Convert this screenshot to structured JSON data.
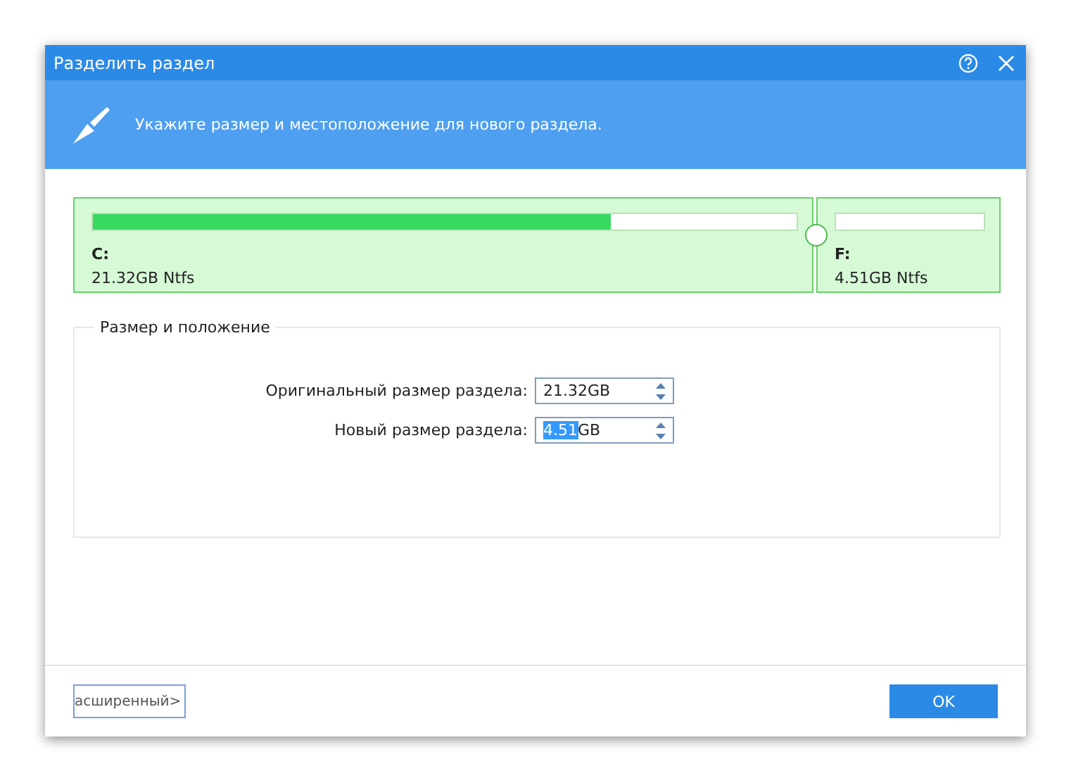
{
  "window": {
    "title": "Разделить раздел"
  },
  "banner": {
    "text": "Укажите размер и местоположение для нового раздела."
  },
  "partitions": [
    {
      "letter": "C:",
      "info": "21.32GB Ntfs",
      "level": 0.735
    },
    {
      "letter": "F:",
      "info": "4.51GB Ntfs"
    }
  ],
  "group": {
    "title": "Размер и положение",
    "fields": [
      {
        "label": "Оригинальный размер раздела:",
        "value": "21.32GB"
      },
      {
        "label": "Новый размер раздела:",
        "value": "GB",
        "selected_text": "4.51"
      }
    ]
  },
  "buttons": {
    "advanced": "асширенный>",
    "ok": "OK"
  }
}
